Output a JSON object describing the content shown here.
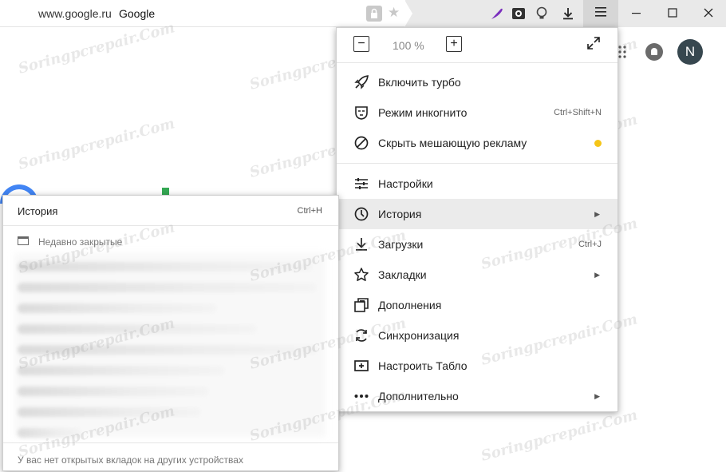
{
  "address_bar": {
    "url": "www.google.ru",
    "page_title": "Google",
    "icons": [
      "lock-icon",
      "star-icon"
    ]
  },
  "toolbar": {
    "extensions": [
      "feather-icon",
      "clapper-icon",
      "bulb-icon",
      "download-icon"
    ],
    "menu_icon": "hamburger-icon",
    "window_buttons": [
      "minimize-icon",
      "maximize-icon",
      "close-icon"
    ]
  },
  "google": {
    "avatar_letter": "N"
  },
  "menu": {
    "zoom": {
      "minus": "−",
      "value": "100 %",
      "plus": "+"
    },
    "items": [
      {
        "label": "Включить турбо",
        "icon": "rocket-icon",
        "shortcut": ""
      },
      {
        "label": "Режим инкогнито",
        "icon": "mask-icon",
        "shortcut": "Ctrl+Shift+N"
      },
      {
        "label": "Скрыть мешающую рекламу",
        "icon": "block-icon",
        "shortcut": ""
      },
      {
        "label": "Настройки",
        "icon": "sliders-icon",
        "shortcut": ""
      },
      {
        "label": "История",
        "icon": "clock-icon",
        "shortcut": "",
        "submenu": true,
        "highlighted": true
      },
      {
        "label": "Загрузки",
        "icon": "download-icon",
        "shortcut": "Ctrl+J"
      },
      {
        "label": "Закладки",
        "icon": "star-icon",
        "shortcut": "",
        "submenu": true
      },
      {
        "label": "Дополнения",
        "icon": "addons-icon",
        "shortcut": ""
      },
      {
        "label": "Синхронизация",
        "icon": "sync-icon",
        "shortcut": ""
      },
      {
        "label": "Настроить Табло",
        "icon": "plus-box-icon",
        "shortcut": ""
      },
      {
        "label": "Дополнительно",
        "icon": "dots-icon",
        "shortcut": "",
        "submenu": true
      }
    ],
    "colors": {
      "highlight": "#ebebeb",
      "ad_dot": "#f5c518"
    }
  },
  "history": {
    "title": "История",
    "shortcut": "Ctrl+H",
    "recently_closed": "Недавно закрытые",
    "footer": "У вас нет открытых вкладок на других устройствах"
  },
  "watermark": "Soringpcrepair.Com"
}
